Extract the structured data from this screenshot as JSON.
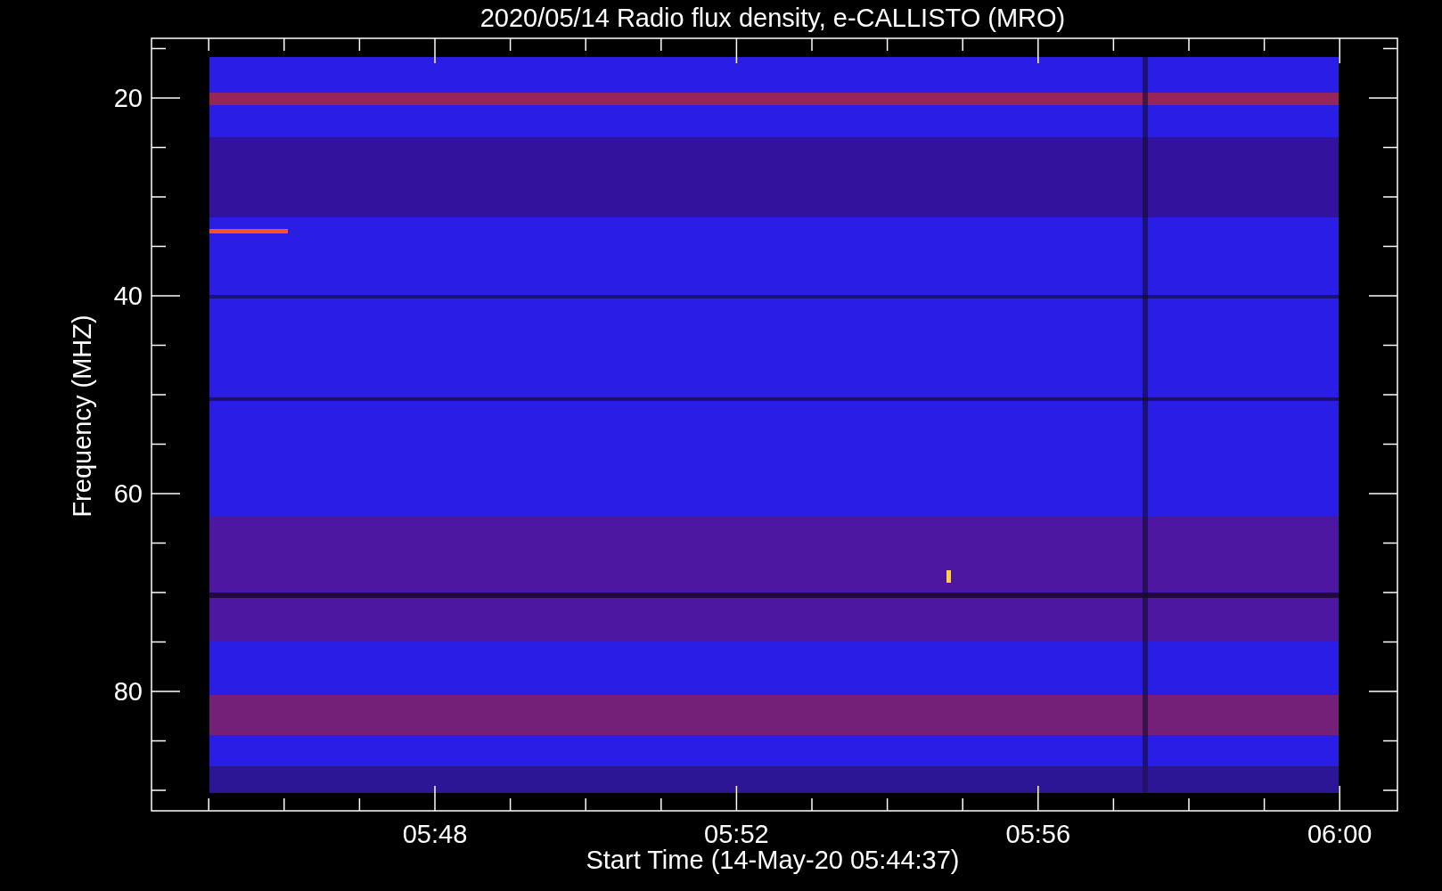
{
  "title": "2020/05/14  Radio flux density, e-CALLISTO (MRO)",
  "ylabel": "Frequency (MHZ)",
  "xlabel": "Start Time (14-May-20 05:44:37)",
  "yticks": [
    "20",
    "40",
    "60",
    "80"
  ],
  "xticks": [
    "05:48",
    "05:52",
    "05:56",
    "06:00"
  ]
}
